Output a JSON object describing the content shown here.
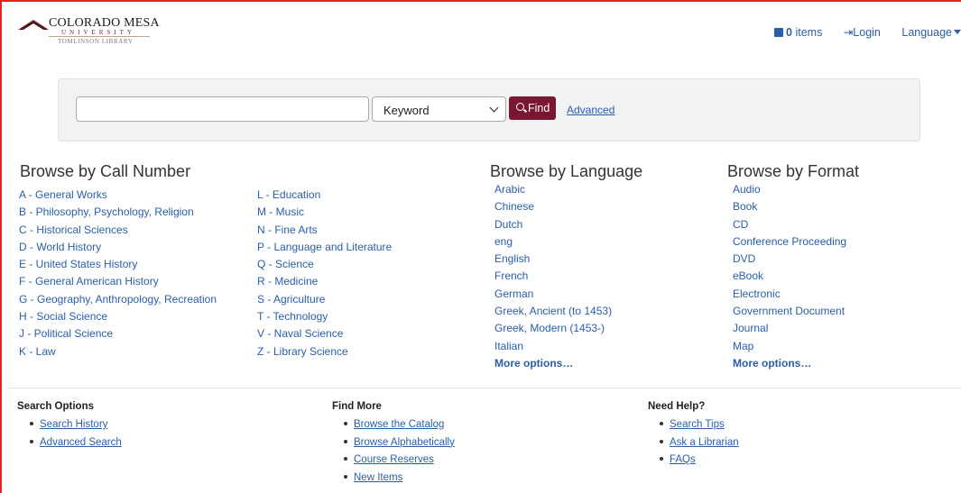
{
  "header": {
    "logo": {
      "name": "COLORADO MESA",
      "university": "UNIVERSITY",
      "library": "TOMLINSON LIBRARY"
    },
    "cart_count": "0",
    "cart_label": "items",
    "login_label": "Login",
    "language_label": "Language"
  },
  "search": {
    "query_value": "",
    "type_selected": "Keyword",
    "find_label": "Find",
    "advanced_label": "Advanced"
  },
  "browse_call_number": {
    "title": "Browse by Call Number",
    "col1": [
      "A - General Works",
      "B - Philosophy, Psychology, Religion",
      "C - Historical Sciences",
      "D - World History",
      "E - United States History",
      "F - General American History",
      "G - Geography, Anthropology, Recreation",
      "H - Social Science",
      "J - Political Science",
      "K - Law"
    ],
    "col2": [
      "L - Education",
      "M - Music",
      "N - Fine Arts",
      "P - Language and Literature",
      "Q - Science",
      "R - Medicine",
      "S - Agriculture",
      "T - Technology",
      "V - Naval Science",
      "Z - Library Science"
    ]
  },
  "browse_language": {
    "title": "Browse by Language",
    "items": [
      "Arabic",
      "Chinese",
      "Dutch",
      "eng",
      "English",
      "French",
      "German",
      "Greek, Ancient (to 1453)",
      "Greek, Modern (1453-)",
      "Italian"
    ],
    "more": "More options…"
  },
  "browse_format": {
    "title": "Browse by Format",
    "items": [
      "Audio",
      "Book",
      "CD",
      "Conference Proceeding",
      "DVD",
      "eBook",
      "Electronic",
      "Government Document",
      "Journal",
      "Map"
    ],
    "more": "More options…"
  },
  "footer": {
    "search_options": {
      "title": "Search Options",
      "links": [
        "Search History",
        "Advanced Search"
      ]
    },
    "find_more": {
      "title": "Find More",
      "links": [
        "Browse the Catalog",
        "Browse Alphabetically",
        "Course Reserves",
        "New Items"
      ]
    },
    "need_help": {
      "title": "Need Help?",
      "links": [
        "Search Tips",
        "Ask a Librarian",
        "FAQs"
      ]
    }
  },
  "colors": {
    "link": "#2a5ea8",
    "find_button": "#7b1630",
    "frame": "#e02424"
  }
}
